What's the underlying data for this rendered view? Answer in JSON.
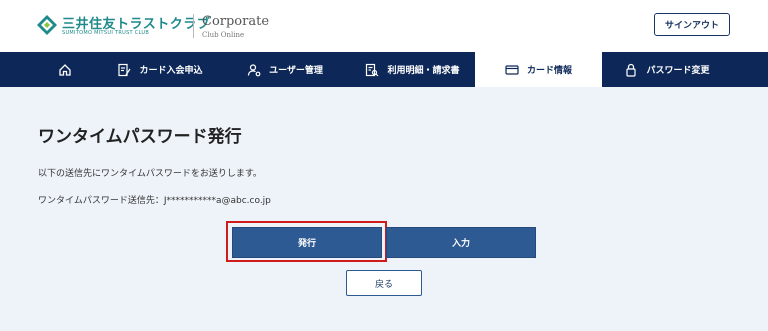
{
  "header": {
    "logo_text": "三井住友トラストクラブ",
    "logo_sub": "SUMITOMO MITSUI TRUST CLUB",
    "corp_title": "Corporate",
    "corp_sub": "Club Online",
    "signout_label": "サインアウト"
  },
  "nav": {
    "items": [
      {
        "label": "",
        "icon": "home-icon"
      },
      {
        "label": "カード入会申込",
        "icon": "edit-icon"
      },
      {
        "label": "ユーザー管理",
        "icon": "user-settings-icon"
      },
      {
        "label": "利用明細・請求書",
        "icon": "document-search-icon"
      },
      {
        "label": "カード情報",
        "icon": "card-icon",
        "active": true
      },
      {
        "label": "パスワード変更",
        "icon": "lock-icon"
      }
    ]
  },
  "main": {
    "title": "ワンタイムパスワード発行",
    "description": "以下の送信先にワンタイムパスワードをお送りします。",
    "destination": "ワンタイムパスワード送信先：J***********a@abc.co.jp",
    "issue_label": "発行",
    "input_label": "入力",
    "back_label": "戻る"
  },
  "colors": {
    "nav_bg": "#0d2858",
    "primary_button": "#2e5a94",
    "highlight": "#d11b1b",
    "page_bg": "#eef3f9"
  }
}
